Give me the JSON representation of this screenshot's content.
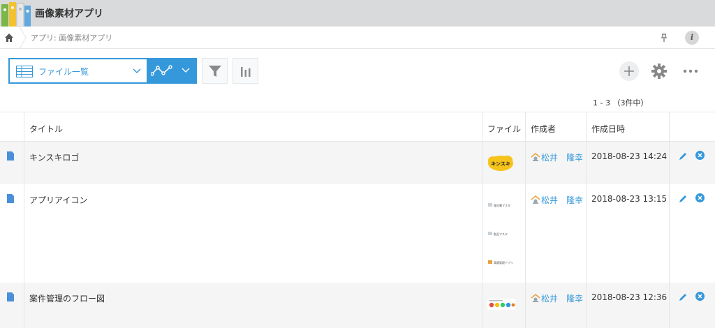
{
  "header": {
    "app_title": "画像素材アプリ"
  },
  "breadcrumb": {
    "text": "アプリ: 画像素材アプリ",
    "info_label": "i"
  },
  "toolbar": {
    "view_label": "ファイル一覧",
    "pagination": "1 - 3 （3件中）"
  },
  "table": {
    "columns": [
      "タイトル",
      "ファイル",
      "作成者",
      "作成日時"
    ],
    "rows": [
      {
        "title": "キンスキロゴ",
        "thumb_text": "キンスキ",
        "creator": "松井　隆幸",
        "created": "2018-08-23 14:24"
      },
      {
        "title": "アプリアイコン",
        "thumb_labels": [
          "報告書マスタ",
          "製品マスタ",
          "実績管理アプリ"
        ],
        "creator": "松井　隆幸",
        "created": "2018-08-23 13:15"
      },
      {
        "title": "案件管理のフロー図",
        "creator": "松井　隆幸",
        "created": "2018-08-23 12:36"
      }
    ]
  },
  "colors": {
    "accent": "#3498db",
    "header_bg": "#d8dadb",
    "row_alt": "#f5f5f5"
  }
}
